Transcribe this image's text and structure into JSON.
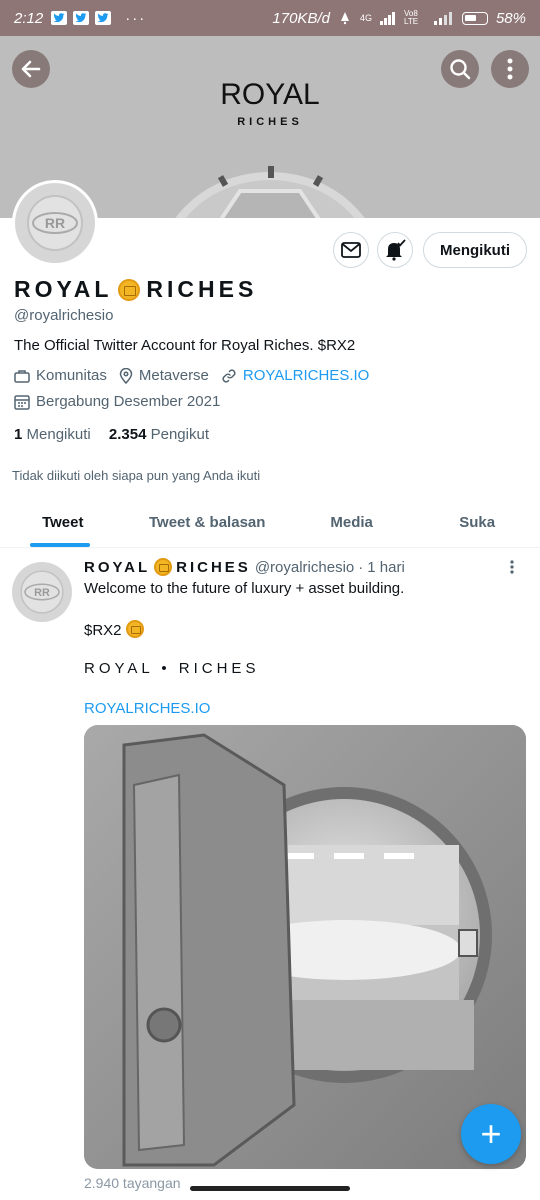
{
  "status_bar": {
    "time": "2:12",
    "dots": "···",
    "network_speed": "170KB/d",
    "signal_label": "4G",
    "volte_label": "Vo8 LTE",
    "battery": "58%",
    "battery_level": 0.58,
    "notification_icons": [
      "twitter-icon",
      "twitter-icon",
      "twitter-icon"
    ]
  },
  "header": {
    "back_icon": "arrow-left-icon",
    "search_icon": "search-icon",
    "more_icon": "more-vertical-icon",
    "banner_title": "ROYAL",
    "banner_subtitle": "RICHES"
  },
  "profile": {
    "name_part1": "ROYAL",
    "name_part2": "RICHES",
    "handle": "@royalrichesio",
    "bio": "The Official Twitter Account for Royal Riches.  $RX2",
    "category": "Komunitas",
    "location": "Metaverse",
    "website": "ROYALRICHES.IO",
    "joined": "Bergabung Desember 2021",
    "following_count": "1",
    "following_label": "Mengikuti",
    "followers_count": "2.354",
    "followers_label": "Pengikut",
    "not_followed_note": "Tidak diikuti oleh siapa pun yang Anda ikuti",
    "follow_button": "Mengikuti",
    "avatar_text": "RR"
  },
  "tabs": [
    {
      "label": "Tweet",
      "active": true
    },
    {
      "label": "Tweet & balasan",
      "active": false
    },
    {
      "label": "Media",
      "active": false
    },
    {
      "label": "Suka",
      "active": false
    }
  ],
  "tweet": {
    "name_part1": "ROYAL",
    "name_part2": "RICHES",
    "handle": "@royalrichesio",
    "separator": "·",
    "time": "1 hari",
    "line1": "Welcome to the future of luxury + asset building.",
    "line2": "$RX2",
    "line3": "ROYAL • RICHES",
    "line4": "ROYALRICHES.IO",
    "more_icon": "more-vertical-icon",
    "partial_text": "2.940 tayangan"
  },
  "colors": {
    "status_bar": "#8f7676",
    "banner": "#bdbdbd",
    "accent": "#1d9bf0",
    "text_primary": "#0f1419",
    "text_secondary": "#536471"
  },
  "fab": {
    "icon": "plus-icon",
    "label": "+"
  }
}
